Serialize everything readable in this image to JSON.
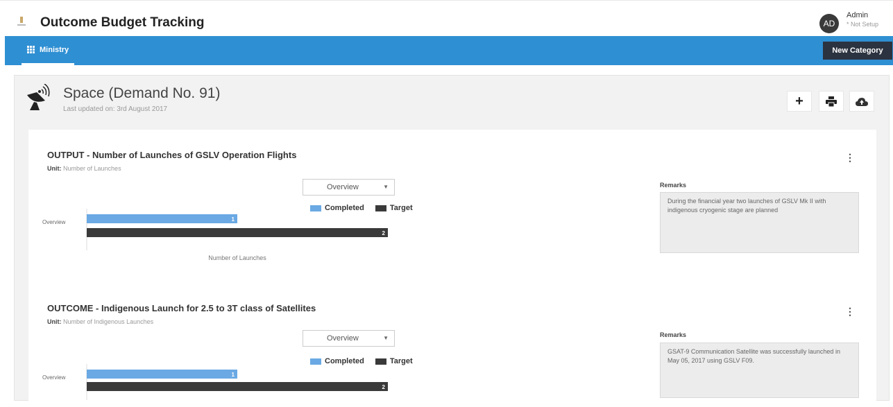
{
  "app": {
    "title": "Outcome Budget Tracking"
  },
  "user": {
    "initials": "AD",
    "name": "Admin",
    "status": "* Not Setup"
  },
  "nav": {
    "ministry_label": "Ministry",
    "new_category_label": "New Category"
  },
  "page": {
    "title": "Space (Demand No. 91)",
    "last_updated": "Last updated on: 3rd August 2017",
    "icons": [
      "plus-icon",
      "print-icon",
      "cloud-upload-icon"
    ]
  },
  "colors": {
    "completed": "#6aa9e3",
    "target": "#3a3a3a",
    "nav": "#2f8fd3"
  },
  "sections": [
    {
      "title": "OUTPUT - Number of Launches of GSLV Operation Flights",
      "unit_label": "Unit:",
      "unit": "Number of Launches",
      "select_value": "Overview",
      "legend": {
        "completed": "Completed",
        "target": "Target"
      },
      "category_label": "Overview",
      "axis_title": "Number of Launches",
      "remarks_label": "Remarks",
      "remarks": "During the financial year two launches of GSLV Mk II with indigenous cryogenic stage are planned"
    },
    {
      "title": "OUTCOME - Indigenous Launch for 2.5 to 3T class of Satellites",
      "unit_label": "Unit:",
      "unit": "Number of Indigenous Launches",
      "select_value": "Overview",
      "legend": {
        "completed": "Completed",
        "target": "Target"
      },
      "category_label": "Overview",
      "axis_title": "",
      "remarks_label": "Remarks",
      "remarks": "GSAT-9 Communication Satellite was successfully launched in May 05, 2017 using GSLV F09."
    }
  ],
  "chart_data": [
    {
      "type": "bar",
      "orientation": "horizontal",
      "categories": [
        "Overview"
      ],
      "series": [
        {
          "name": "Completed",
          "values": [
            1
          ]
        },
        {
          "name": "Target",
          "values": [
            2
          ]
        }
      ],
      "xlabel": "Number of Launches",
      "xlim": [
        0,
        2
      ],
      "legend": "top-right"
    },
    {
      "type": "bar",
      "orientation": "horizontal",
      "categories": [
        "Overview"
      ],
      "series": [
        {
          "name": "Completed",
          "values": [
            1
          ]
        },
        {
          "name": "Target",
          "values": [
            2
          ]
        }
      ],
      "xlim": [
        0,
        2
      ],
      "legend": "top-right"
    }
  ]
}
